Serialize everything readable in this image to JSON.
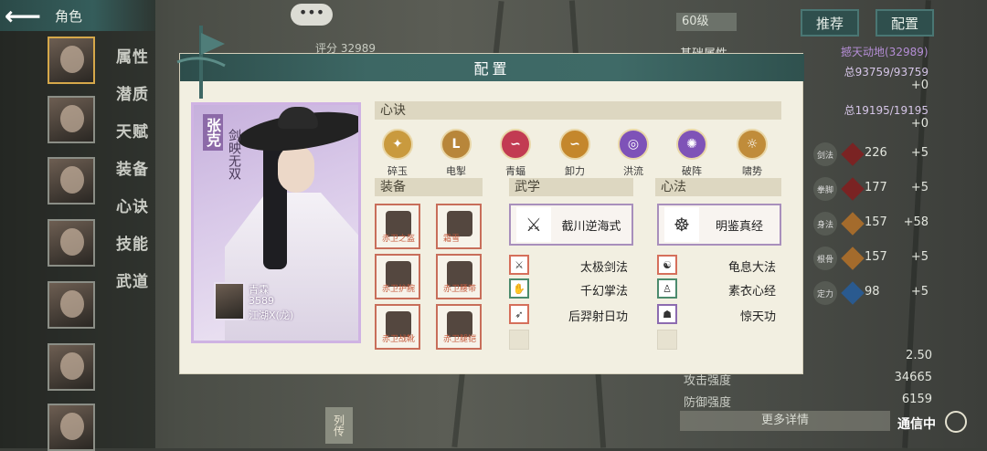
{
  "header": {
    "title": "角色",
    "level": "60级",
    "recommend": "推荐",
    "config": "配置"
  },
  "chat_dots": "•••",
  "score": "评分 32989",
  "sidebar": {
    "tabs": [
      "属性",
      "潜质",
      "天赋",
      "装备",
      "心诀",
      "技能",
      "武道"
    ]
  },
  "right_stats": {
    "rows": [
      {
        "icon": "剑法",
        "val": "226",
        "plus": "+5",
        "gem": "red"
      },
      {
        "icon": "拳脚",
        "val": "177",
        "plus": "+5",
        "gem": "red"
      },
      {
        "icon": "身法",
        "val": "157",
        "plus": "+58",
        "gem": "orange"
      },
      {
        "icon": "根骨",
        "val": "157",
        "plus": "+5",
        "gem": "orange"
      },
      {
        "icon": "定力",
        "val": "98",
        "plus": "+5",
        "gem": "blue"
      }
    ],
    "top_right_small": "总93759/93759",
    "top_right_small2": "总19195/19195",
    "plus0a": "+0",
    "plus0b": "+0",
    "value1": "2.50",
    "atk_label": "攻击强度",
    "atk_val": "34665",
    "def_label": "防御强度",
    "def_val": "6159",
    "more": "更多详情",
    "comm": "通信中",
    "basic_label": "基础属性",
    "resist_label": "撼天动地(32989)"
  },
  "liezhuan": "列传",
  "modal": {
    "title": "配置",
    "card": {
      "name": "张克",
      "title": "剑映无双",
      "line1": "青霖",
      "line2": "3589",
      "line3": "江湖X(龙)"
    },
    "sections": {
      "xinjue": "心诀",
      "equip": "装备",
      "wuxue": "武学",
      "xinfa": "心法"
    },
    "xinjue": [
      {
        "label": "碎玉",
        "color": "#c99a3e",
        "glyph": "✦"
      },
      {
        "label": "电掣",
        "color": "#b8863a",
        "glyph": "L"
      },
      {
        "label": "青蝠",
        "color": "#c23b52",
        "glyph": "∽"
      },
      {
        "label": "卸力",
        "color": "#c4872c",
        "glyph": "∽"
      },
      {
        "label": "洪流",
        "color": "#7e52b8",
        "glyph": "◎"
      },
      {
        "label": "破阵",
        "color": "#7f53b7",
        "glyph": "✺"
      },
      {
        "label": "啸势",
        "color": "#c08c3a",
        "glyph": "☼"
      }
    ],
    "equip_tags": [
      "赤卫之盔",
      "霜雪",
      "赤卫护腕",
      "赤卫腰带",
      "赤卫战靴",
      "赤卫腿铠"
    ],
    "wuxue_main": "截川逆海式",
    "wuxue_list": [
      "太极剑法",
      "千幻掌法",
      "后羿射日功"
    ],
    "xinfa_main": "明鉴真经",
    "xinfa_list": [
      "龟息大法",
      "素衣心经",
      "惊天功"
    ]
  }
}
